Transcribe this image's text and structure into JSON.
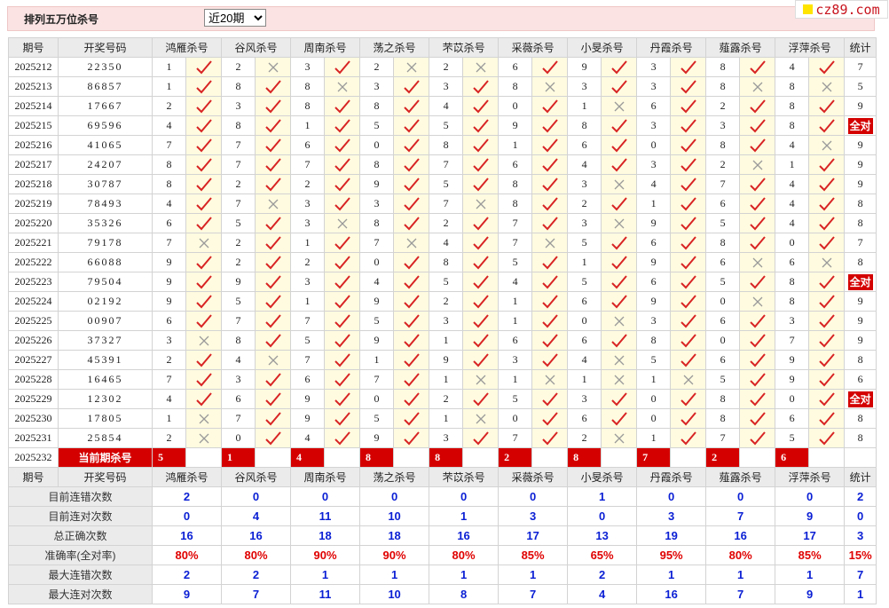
{
  "header": {
    "title": "排列五万位杀号",
    "range_selected": "近20期",
    "logo_text": "cz89.com"
  },
  "columns": {
    "period": "期号",
    "winning": "开奖号码",
    "total": "统计",
    "experts": [
      "鸿雁杀号",
      "谷风杀号",
      "周南杀号",
      "荡之杀号",
      "芣苡杀号",
      "采薇杀号",
      "小旻杀号",
      "丹霞杀号",
      "薤露杀号",
      "浮萍杀号"
    ]
  },
  "rows": [
    {
      "period": "2025212",
      "win": "22350",
      "kill": [
        "1",
        "2",
        "3",
        "2",
        "2",
        "6",
        "9",
        "3",
        "8",
        "4"
      ],
      "ok": [
        1,
        0,
        1,
        0,
        0,
        1,
        1,
        1,
        1,
        1
      ],
      "total": "7"
    },
    {
      "period": "2025213",
      "win": "86857",
      "kill": [
        "1",
        "8",
        "8",
        "3",
        "3",
        "8",
        "3",
        "3",
        "8",
        "8"
      ],
      "ok": [
        1,
        1,
        0,
        1,
        1,
        0,
        1,
        1,
        0,
        0
      ],
      "total": "5"
    },
    {
      "period": "2025214",
      "win": "17667",
      "kill": [
        "2",
        "3",
        "8",
        "8",
        "4",
        "0",
        "1",
        "6",
        "2",
        "8"
      ],
      "ok": [
        1,
        1,
        1,
        1,
        1,
        1,
        0,
        1,
        1,
        1
      ],
      "total": "9"
    },
    {
      "period": "2025215",
      "win": "69596",
      "kill": [
        "4",
        "8",
        "1",
        "5",
        "5",
        "9",
        "8",
        "3",
        "3",
        "8"
      ],
      "ok": [
        1,
        1,
        1,
        1,
        1,
        1,
        1,
        1,
        1,
        1
      ],
      "total": "全对"
    },
    {
      "period": "2025216",
      "win": "41065",
      "kill": [
        "7",
        "7",
        "6",
        "0",
        "8",
        "1",
        "6",
        "0",
        "8",
        "4"
      ],
      "ok": [
        1,
        1,
        1,
        1,
        1,
        1,
        1,
        1,
        1,
        0
      ],
      "total": "9"
    },
    {
      "period": "2025217",
      "win": "24207",
      "kill": [
        "8",
        "7",
        "7",
        "8",
        "7",
        "6",
        "4",
        "3",
        "2",
        "1"
      ],
      "ok": [
        1,
        1,
        1,
        1,
        1,
        1,
        1,
        1,
        0,
        1
      ],
      "total": "9"
    },
    {
      "period": "2025218",
      "win": "30787",
      "kill": [
        "8",
        "2",
        "2",
        "9",
        "5",
        "8",
        "3",
        "4",
        "7",
        "4"
      ],
      "ok": [
        1,
        1,
        1,
        1,
        1,
        1,
        0,
        1,
        1,
        1
      ],
      "total": "9"
    },
    {
      "period": "2025219",
      "win": "78493",
      "kill": [
        "4",
        "7",
        "3",
        "3",
        "7",
        "8",
        "2",
        "1",
        "6",
        "4"
      ],
      "ok": [
        1,
        0,
        1,
        1,
        0,
        1,
        1,
        1,
        1,
        1
      ],
      "total": "8"
    },
    {
      "period": "2025220",
      "win": "35326",
      "kill": [
        "6",
        "5",
        "3",
        "8",
        "2",
        "7",
        "3",
        "9",
        "5",
        "4"
      ],
      "ok": [
        1,
        1,
        0,
        1,
        1,
        1,
        0,
        1,
        1,
        1
      ],
      "total": "8"
    },
    {
      "period": "2025221",
      "win": "79178",
      "kill": [
        "7",
        "2",
        "1",
        "7",
        "4",
        "7",
        "5",
        "6",
        "8",
        "0"
      ],
      "ok": [
        0,
        1,
        1,
        0,
        1,
        0,
        1,
        1,
        1,
        1
      ],
      "total": "7"
    },
    {
      "period": "2025222",
      "win": "66088",
      "kill": [
        "9",
        "2",
        "2",
        "0",
        "8",
        "5",
        "1",
        "9",
        "6",
        "6"
      ],
      "ok": [
        1,
        1,
        1,
        1,
        1,
        1,
        1,
        1,
        0,
        0
      ],
      "total": "8"
    },
    {
      "period": "2025223",
      "win": "79504",
      "kill": [
        "9",
        "9",
        "3",
        "4",
        "5",
        "4",
        "5",
        "6",
        "5",
        "8"
      ],
      "ok": [
        1,
        1,
        1,
        1,
        1,
        1,
        1,
        1,
        1,
        1
      ],
      "total": "全对"
    },
    {
      "period": "2025224",
      "win": "02192",
      "kill": [
        "9",
        "5",
        "1",
        "9",
        "2",
        "1",
        "6",
        "9",
        "0",
        "8"
      ],
      "ok": [
        1,
        1,
        1,
        1,
        1,
        1,
        1,
        1,
        0,
        1
      ],
      "total": "9"
    },
    {
      "period": "2025225",
      "win": "00907",
      "kill": [
        "6",
        "7",
        "7",
        "5",
        "3",
        "1",
        "0",
        "3",
        "6",
        "3"
      ],
      "ok": [
        1,
        1,
        1,
        1,
        1,
        1,
        0,
        1,
        1,
        1
      ],
      "total": "9"
    },
    {
      "period": "2025226",
      "win": "37327",
      "kill": [
        "3",
        "8",
        "5",
        "9",
        "1",
        "6",
        "6",
        "8",
        "0",
        "7"
      ],
      "ok": [
        0,
        1,
        1,
        1,
        1,
        1,
        1,
        1,
        1,
        1
      ],
      "total": "9"
    },
    {
      "period": "2025227",
      "win": "45391",
      "kill": [
        "2",
        "4",
        "7",
        "1",
        "9",
        "3",
        "4",
        "5",
        "6",
        "9"
      ],
      "ok": [
        1,
        0,
        1,
        1,
        1,
        1,
        0,
        1,
        1,
        1
      ],
      "total": "8"
    },
    {
      "period": "2025228",
      "win": "16465",
      "kill": [
        "7",
        "3",
        "6",
        "7",
        "1",
        "1",
        "1",
        "1",
        "5",
        "9"
      ],
      "ok": [
        1,
        1,
        1,
        1,
        0,
        0,
        0,
        0,
        1,
        1
      ],
      "total": "6"
    },
    {
      "period": "2025229",
      "win": "12302",
      "kill": [
        "4",
        "6",
        "9",
        "0",
        "2",
        "5",
        "3",
        "0",
        "8",
        "0"
      ],
      "ok": [
        1,
        1,
        1,
        1,
        1,
        1,
        1,
        1,
        1,
        1
      ],
      "total": "全对"
    },
    {
      "period": "2025230",
      "win": "17805",
      "kill": [
        "1",
        "7",
        "9",
        "5",
        "1",
        "0",
        "6",
        "0",
        "8",
        "6"
      ],
      "ok": [
        0,
        1,
        1,
        1,
        0,
        1,
        1,
        1,
        1,
        1
      ],
      "total": "8"
    },
    {
      "period": "2025231",
      "win": "25854",
      "kill": [
        "2",
        "0",
        "4",
        "9",
        "3",
        "7",
        "2",
        "1",
        "7",
        "5"
      ],
      "ok": [
        0,
        1,
        1,
        1,
        1,
        1,
        0,
        1,
        1,
        1
      ],
      "total": "8"
    }
  ],
  "current": {
    "period": "2025232",
    "label": "当前期杀号",
    "kill": [
      "5",
      "1",
      "4",
      "8",
      "8",
      "2",
      "8",
      "7",
      "2",
      "6"
    ]
  },
  "stats": [
    {
      "label": "目前连错次数",
      "values": [
        "2",
        "0",
        "0",
        "0",
        "0",
        "0",
        "1",
        "0",
        "0",
        "0"
      ],
      "total": "2",
      "pct": false
    },
    {
      "label": "目前连对次数",
      "values": [
        "0",
        "4",
        "11",
        "10",
        "1",
        "3",
        "0",
        "3",
        "7",
        "9"
      ],
      "total": "0",
      "pct": false
    },
    {
      "label": "总正确次数",
      "values": [
        "16",
        "16",
        "18",
        "18",
        "16",
        "17",
        "13",
        "19",
        "16",
        "17"
      ],
      "total": "3",
      "pct": false
    },
    {
      "label": "准确率(全对率)",
      "values": [
        "80%",
        "80%",
        "90%",
        "90%",
        "80%",
        "85%",
        "65%",
        "95%",
        "80%",
        "85%"
      ],
      "total": "15%",
      "pct": true
    },
    {
      "label": "最大连错次数",
      "values": [
        "2",
        "2",
        "1",
        "1",
        "1",
        "1",
        "2",
        "1",
        "1",
        "1"
      ],
      "total": "7",
      "pct": false
    },
    {
      "label": "最大连对次数",
      "values": [
        "9",
        "7",
        "11",
        "10",
        "8",
        "7",
        "4",
        "16",
        "7",
        "9"
      ],
      "total": "1",
      "pct": false
    }
  ]
}
